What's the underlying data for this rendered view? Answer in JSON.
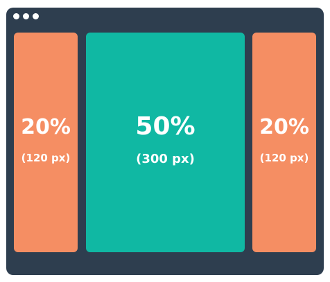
{
  "window": {
    "frame_color": "#2e3e4f",
    "controls": [
      "dot",
      "dot",
      "dot"
    ]
  },
  "columns": [
    {
      "percent": "20%",
      "pixels": "(120 px)",
      "color": "#f58e63"
    },
    {
      "percent": "50%",
      "pixels": "(300 px)",
      "color": "#10b8a3"
    },
    {
      "percent": "20%",
      "pixels": "(120 px)",
      "color": "#f58e63"
    }
  ]
}
